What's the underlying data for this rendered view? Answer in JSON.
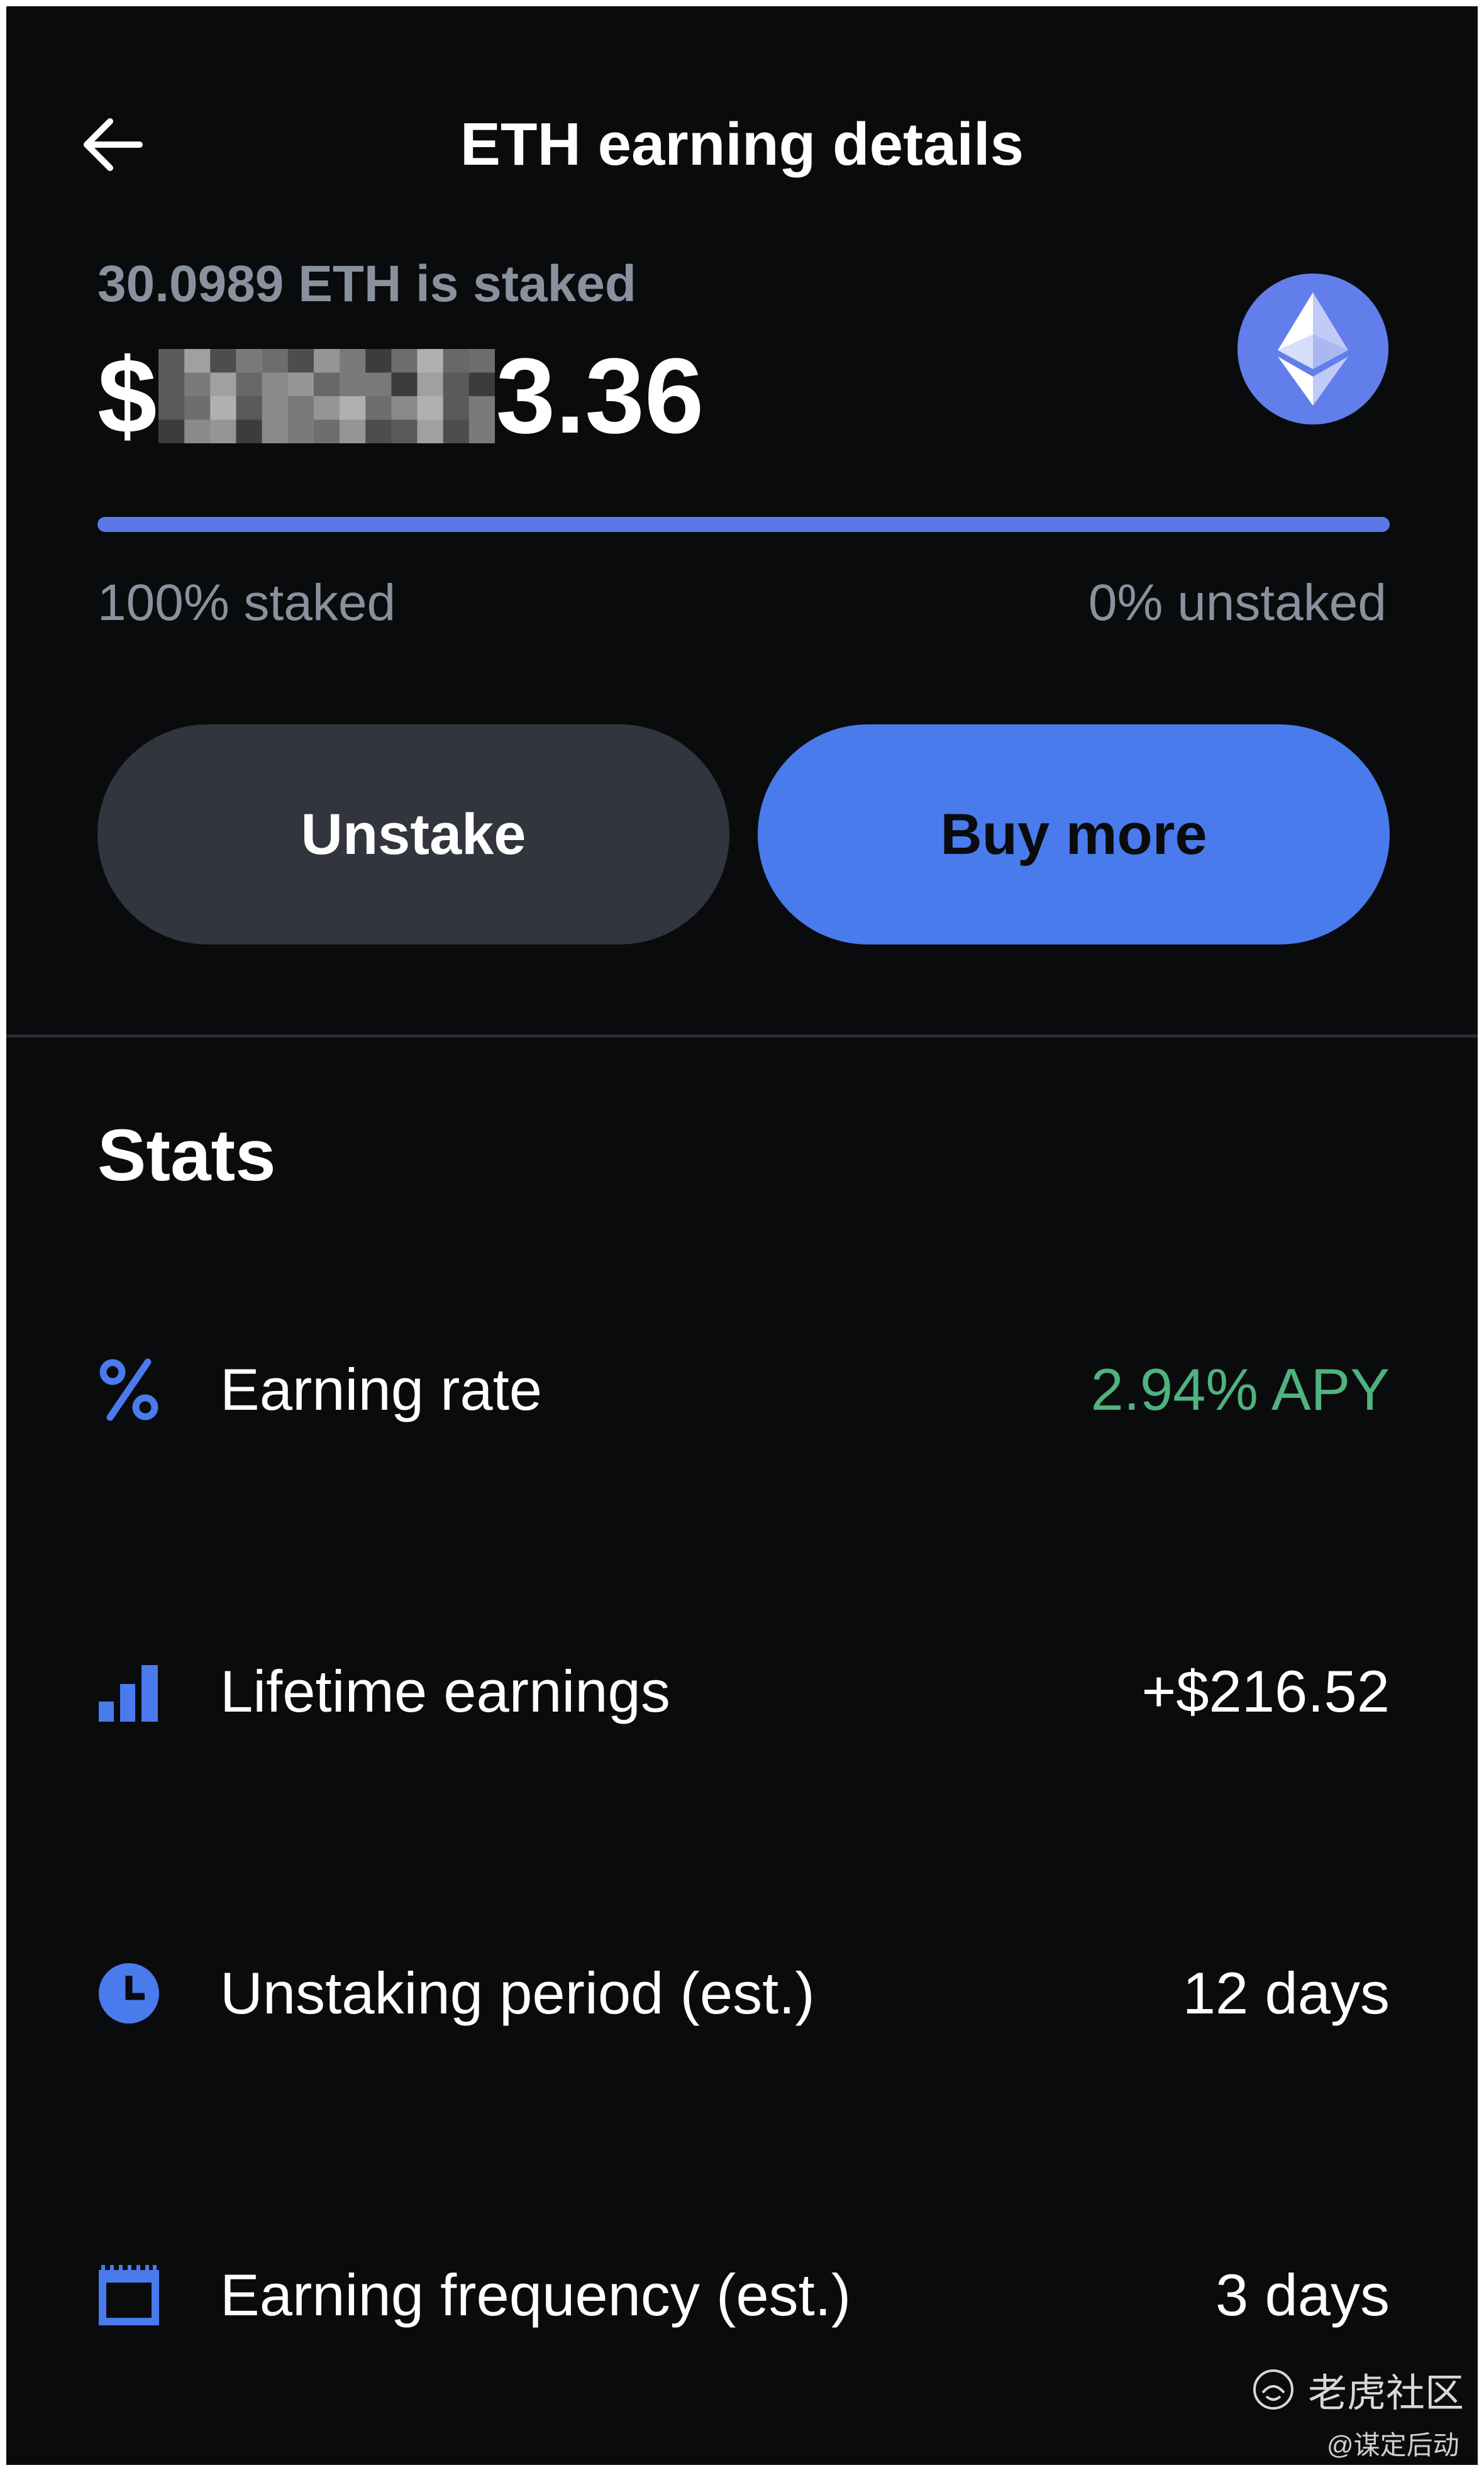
{
  "header": {
    "title": "ETH earning details",
    "back_icon": "arrow-left-icon"
  },
  "balance": {
    "staked_amount": "30.0989 ETH is staked",
    "prefix": "$",
    "suffix": "3.36",
    "asset_icon": "ethereum-icon",
    "asset_color": "#627eea"
  },
  "progress": {
    "staked_fraction": 1.0,
    "staked_label": "100% staked",
    "unstaked_label": "0% unstaked"
  },
  "actions": {
    "unstake_label": "Unstake",
    "buy_label": "Buy more"
  },
  "stats": {
    "heading": "Stats",
    "rows": [
      {
        "icon": "percent-icon",
        "label": "Earning rate",
        "value": "2.94% APY",
        "value_color": "#4fb27f"
      },
      {
        "icon": "bar-chart-icon",
        "label": "Lifetime earnings",
        "value": "+$216.52",
        "value_color": "#ffffff"
      },
      {
        "icon": "clock-icon",
        "label": "Unstaking period (est.)",
        "value": "12 days",
        "value_color": "#ffffff"
      },
      {
        "icon": "calendar-icon",
        "label": "Earning frequency (est.)",
        "value": "3 days",
        "value_color": "#ffffff"
      }
    ]
  },
  "watermark": {
    "line1": "老虎社区",
    "line2": "@谋定后动"
  },
  "colors": {
    "background": "#0a0b0d",
    "accent": "#4a7bec",
    "muted": "#8a919e",
    "positive": "#4fb27f"
  }
}
